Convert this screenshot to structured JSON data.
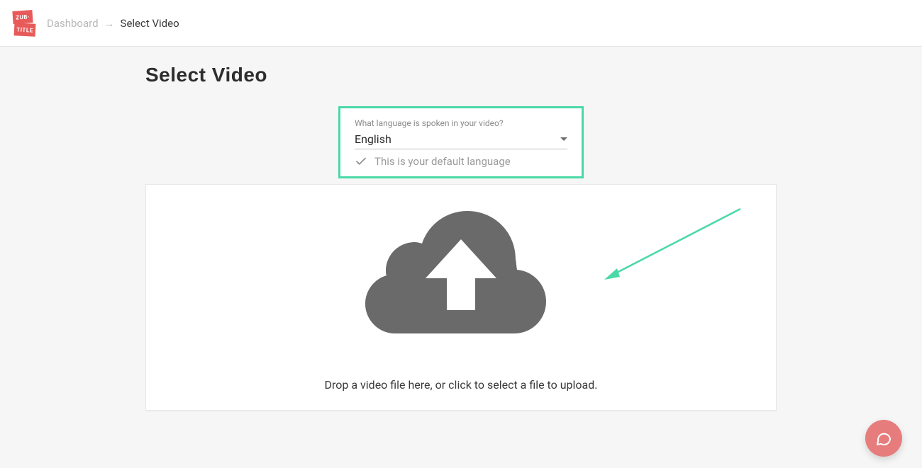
{
  "logo": {
    "top": "ZUB·",
    "bottom": "TITLE"
  },
  "breadcrumb": {
    "dashboard": "Dashboard",
    "separator": "→",
    "current": "Select Video"
  },
  "page_title": "Select Video",
  "language": {
    "label": "What language is spoken in your video?",
    "value": "English",
    "hint": "This is your default language"
  },
  "dropzone": {
    "text": "Drop a video file here, or click to select a file to upload."
  },
  "colors": {
    "accent": "#4ad9a6",
    "brand": "#e85a5a",
    "fab": "#e77c7c"
  }
}
